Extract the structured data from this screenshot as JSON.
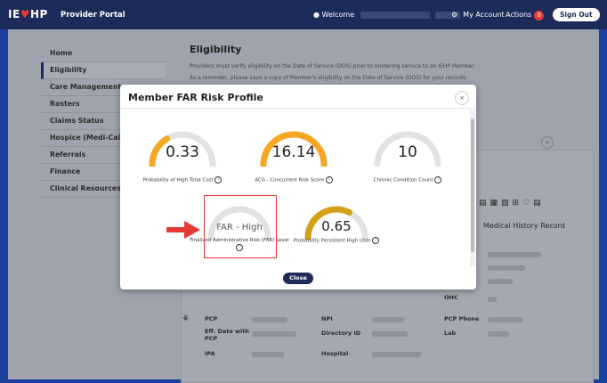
{
  "header": {
    "logo_prefix": "IE",
    "logo_heart": "♥",
    "logo_suffix": "HP",
    "portal_title": "Provider Portal",
    "welcome_label": "Welcome",
    "my_account": "My Account",
    "actions": "Actions",
    "actions_count": "0",
    "sign_out": "Sign Out"
  },
  "sidebar": {
    "items": [
      {
        "label": "Home"
      },
      {
        "label": "Eligibility"
      },
      {
        "label": "Care Management"
      },
      {
        "label": "Rosters"
      },
      {
        "label": "Claims Status"
      },
      {
        "label": "Hospice (Medi-Cal)"
      },
      {
        "label": "Referrals"
      },
      {
        "label": "Finance"
      },
      {
        "label": "Clinical Resources and"
      }
    ]
  },
  "main": {
    "title": "Eligibility",
    "line1": "Providers must verify eligibility on the Date of Service (DOS) prior to rendering service to an IEHP Member.",
    "line2": "As a reminder, please save a copy of Member's eligibility on the Date of Service (DOS) for your records.",
    "medical_history": "Medical History Record",
    "ohc": "OHC",
    "pcp_section": {
      "pcp": "PCP",
      "eff_date": "Eff. Date with PCP",
      "ipa": "IPA",
      "npi": "NPI",
      "directory_id": "Directory ID",
      "hospital": "Hospital",
      "pcp_phone": "PCP Phone",
      "lab": "Lab"
    }
  },
  "modal": {
    "title": "Member FAR Risk Profile",
    "close_x": "×",
    "close_button": "Close",
    "gauges": [
      {
        "value": "0.33",
        "label": "Probability of High Total Cost",
        "fill": 0.33,
        "color": "#f5a623"
      },
      {
        "value": "16.14",
        "label": "ACG - Concurrent Risk Score",
        "fill": 1.0,
        "color": "#f5a623"
      },
      {
        "value": "10",
        "label": "Chronic Condition Count",
        "fill": 0.0,
        "color": "#f5a623"
      },
      {
        "value": "FAR - High",
        "label": "Finalized Administrative Risk (FAR) Level",
        "fill": 0.0,
        "color": "#cccccc"
      },
      {
        "value": "0.65",
        "label": "Probability Persistent High User",
        "fill": 0.65,
        "color": "#d4a017"
      }
    ]
  },
  "colors": {
    "brand_navy": "#1d2b5a",
    "accent_red": "#e53935",
    "gauge_orange": "#f5a623",
    "gauge_track": "#e2e2e2"
  }
}
